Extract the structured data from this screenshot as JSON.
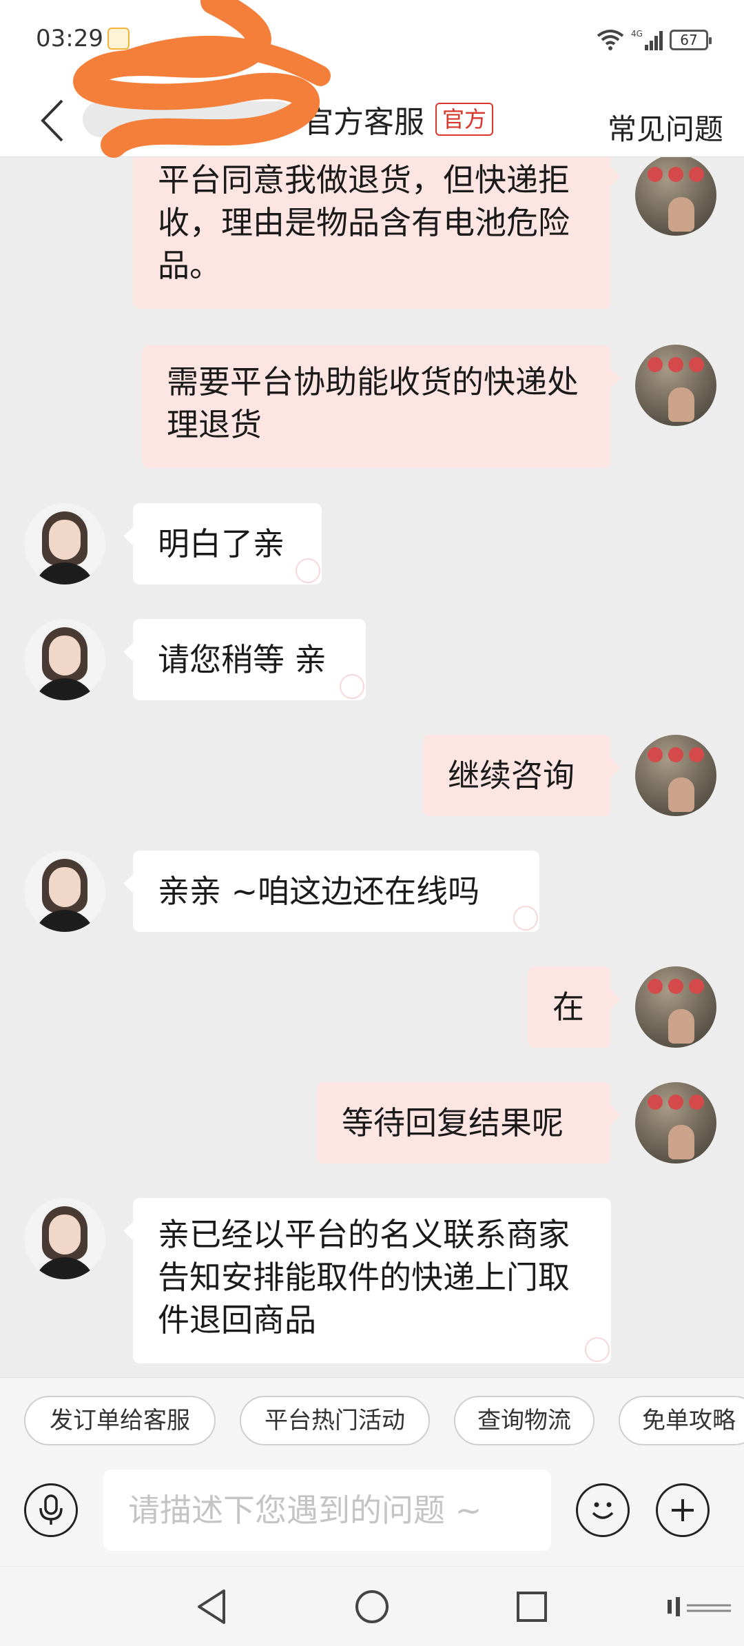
{
  "status_bar": {
    "time": "03:29",
    "network": "4G",
    "battery": "67"
  },
  "header": {
    "title": "官方客服",
    "badge": "官方",
    "faq": "常见问题"
  },
  "messages": [
    {
      "sender": "user",
      "text": "平台同意我做退货，但快递拒收，理由是物品含有电池危险品。"
    },
    {
      "sender": "user",
      "text": "需要平台协助能收货的快递处理退货"
    },
    {
      "sender": "agent",
      "text": "明白了亲"
    },
    {
      "sender": "agent",
      "text": "请您稍等 亲"
    },
    {
      "sender": "user",
      "text": "继续咨询"
    },
    {
      "sender": "agent",
      "text": "亲亲 ~咱这边还在线吗"
    },
    {
      "sender": "user",
      "text": "在"
    },
    {
      "sender": "user",
      "text": "等待回复结果呢"
    },
    {
      "sender": "agent",
      "text": "亲已经以平台的名义联系商家告知安排能取件的快递上门取件退回商品"
    }
  ],
  "quick_chips": [
    "发订单给客服",
    "平台热门活动",
    "查询物流",
    "免单攻略"
  ],
  "input": {
    "placeholder": "请描述下您遇到的问题 ~",
    "value": ""
  },
  "colors": {
    "user_bubble": "#fde5e4",
    "agent_bubble": "#ffffff",
    "badge_red": "#d9362b",
    "redaction_orange": "#f47f3a"
  }
}
